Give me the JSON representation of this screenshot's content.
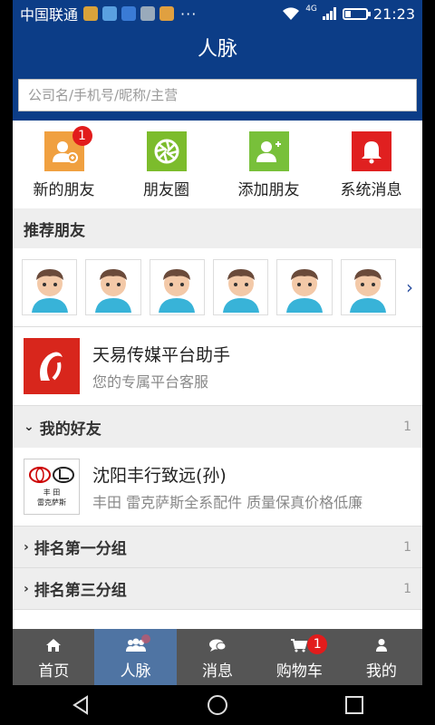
{
  "status_bar": {
    "carrier": "中国联通",
    "dots": "···",
    "network": "4G",
    "time": "21:23"
  },
  "header": {
    "title": "人脉"
  },
  "search": {
    "placeholder": "公司名/手机号/昵称/主营"
  },
  "quick_actions": [
    {
      "label": "新的朋友",
      "icon": "new-friend-icon",
      "color": "#f0a040",
      "badge": "1"
    },
    {
      "label": "朋友圈",
      "icon": "moments-icon",
      "color": "#7cbc2c"
    },
    {
      "label": "添加朋友",
      "icon": "add-friend-icon",
      "color": "#78c03a"
    },
    {
      "label": "系统消息",
      "icon": "bell-icon",
      "color": "#e02020"
    }
  ],
  "recommended": {
    "title": "推荐朋友"
  },
  "assistant": {
    "title": "天易传媒平台助手",
    "subtitle": "您的专属平台客服"
  },
  "my_friends": {
    "title": "我的好友",
    "count": "1"
  },
  "friends": [
    {
      "title": "沈阳丰行致远(孙)",
      "subtitle": "丰田 雷克萨斯全系配件 质量保真价格低廉",
      "logo_text_1": "丰   田",
      "logo_text_2": "雷克萨斯"
    }
  ],
  "groups": [
    {
      "title": "排名第一分组",
      "count": "1"
    },
    {
      "title": "排名第三分组",
      "count": "1"
    }
  ],
  "tabs": [
    {
      "label": "首页",
      "icon": "home-icon"
    },
    {
      "label": "人脉",
      "icon": "contacts-icon",
      "active": true
    },
    {
      "label": "消息",
      "icon": "chat-icon"
    },
    {
      "label": "购物车",
      "icon": "cart-icon",
      "badge": "1"
    },
    {
      "label": "我的",
      "icon": "user-icon"
    }
  ],
  "colors": {
    "primary": "#0c3d87",
    "tab_bg": "#555555",
    "tab_active": "#4f74a3",
    "badge": "#e21c1c"
  }
}
